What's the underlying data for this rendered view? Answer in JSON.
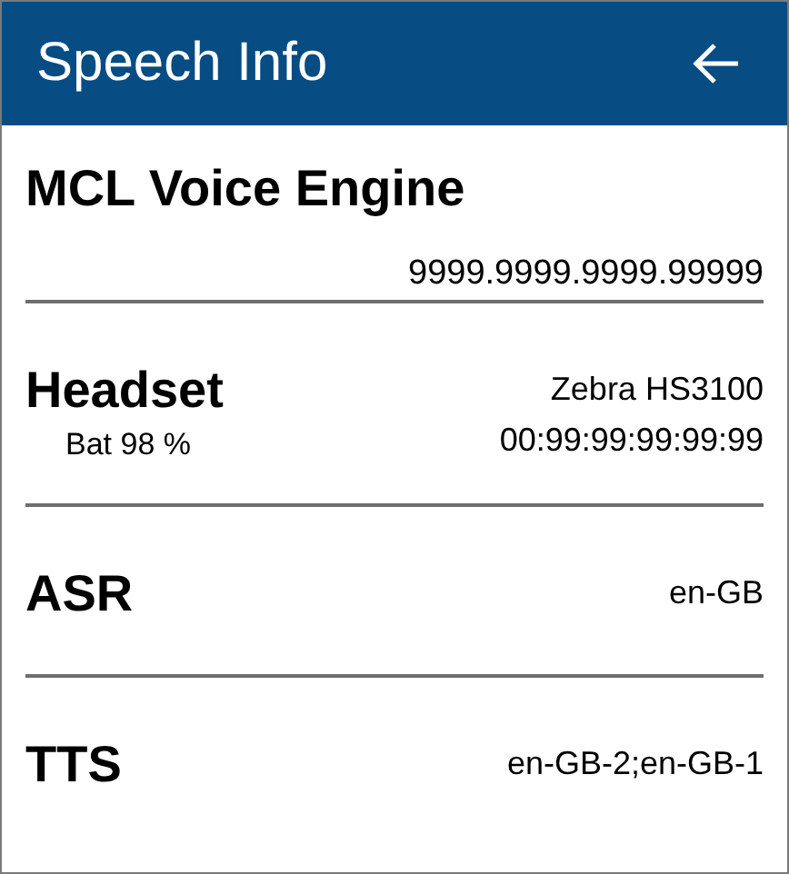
{
  "app_bar": {
    "title": "Speech Info"
  },
  "sections": [
    {
      "kind": "stacked",
      "title": "MCL Voice Engine",
      "values": [
        "9999.9999.9999.99999"
      ]
    },
    {
      "kind": "split",
      "title": "Headset",
      "subtitle": "Bat 98 %",
      "values": [
        "Zebra HS3100",
        "00:99:99:99:99:99"
      ]
    },
    {
      "kind": "split",
      "title": "ASR",
      "values": [
        "en-GB"
      ]
    },
    {
      "kind": "split",
      "title": "TTS",
      "values": [
        "en-GB-2;en-GB-1"
      ]
    }
  ]
}
